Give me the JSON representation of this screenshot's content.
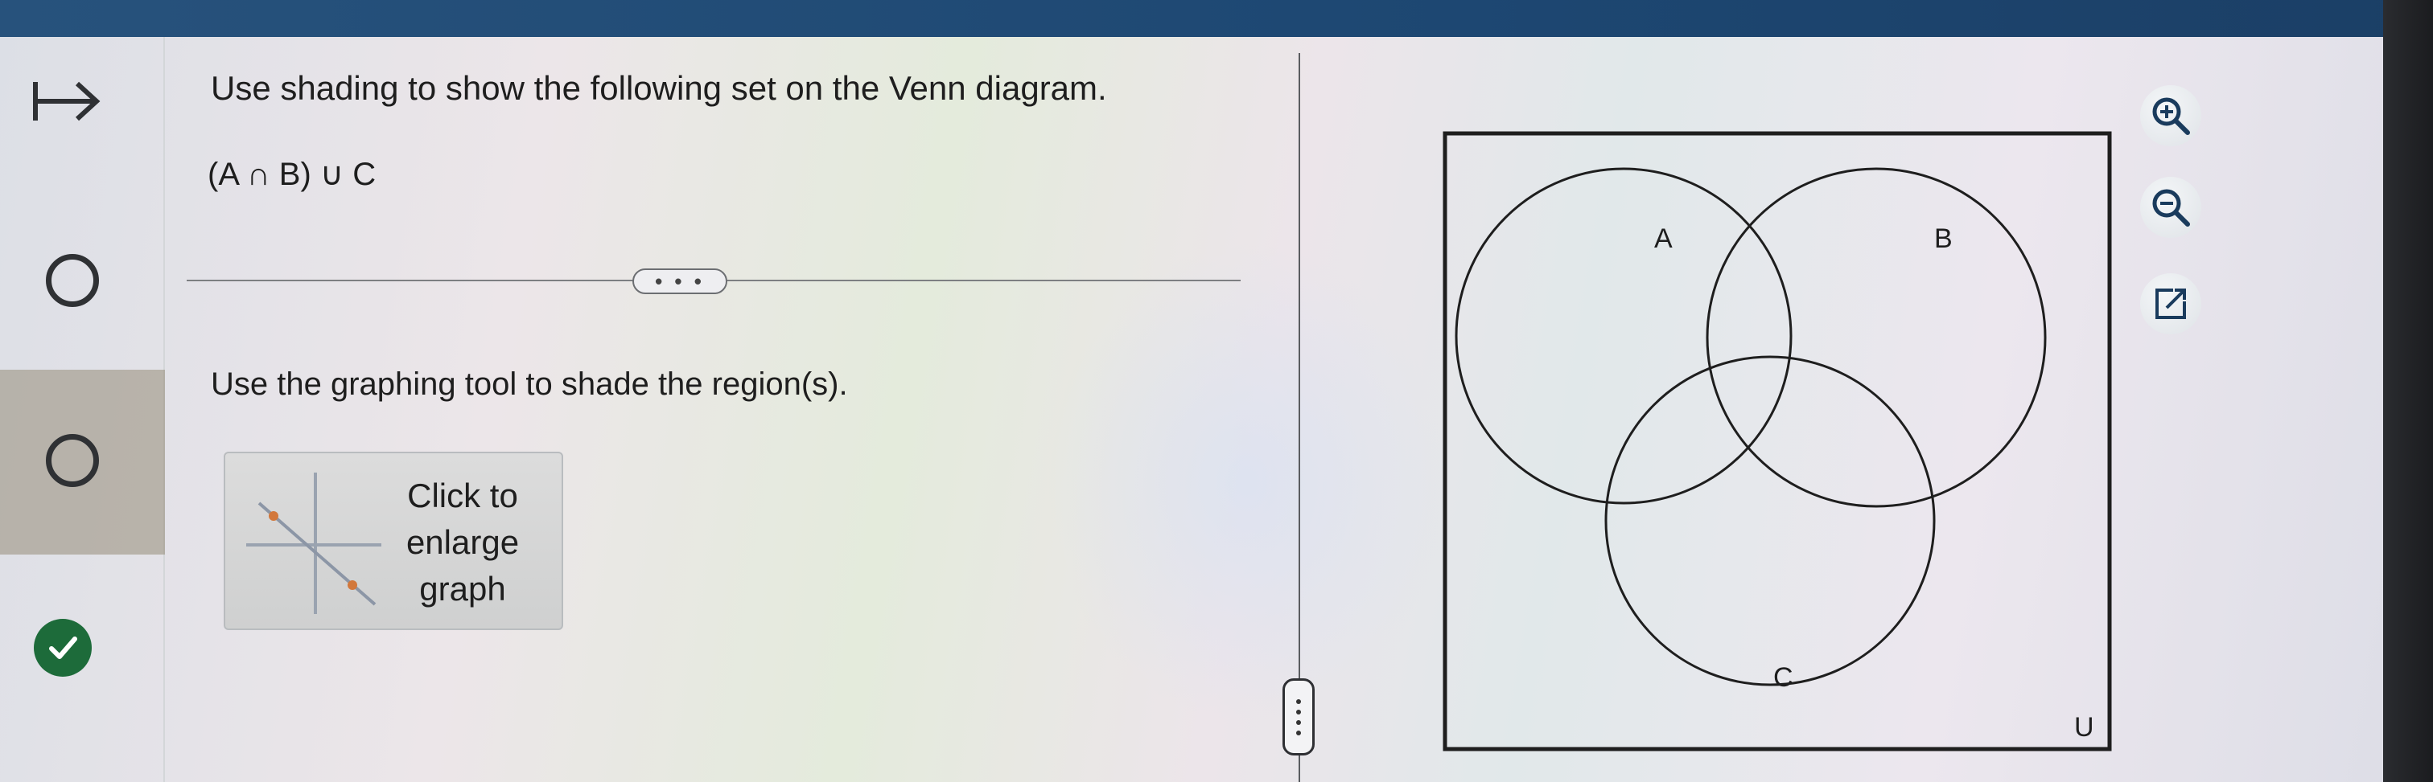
{
  "question": {
    "prompt": "Use shading to show the following set on the Venn diagram.",
    "expression": "(A ∩ B) ∪ C"
  },
  "toolbar": {
    "more_label": "• • •"
  },
  "instruction": "Use the graphing tool to shade the region(s).",
  "graph_button": {
    "line1": "Click to",
    "line2": "enlarge",
    "line3": "graph"
  },
  "venn": {
    "set_labels": [
      "A",
      "B",
      "C"
    ],
    "universe_label": "U"
  },
  "tools": {
    "icons": [
      "zoom-in-icon",
      "zoom-out-icon",
      "open-external-icon"
    ]
  },
  "left_rail": {
    "icons": [
      "collapse-arrow-icon",
      "radio-circle-icon",
      "radio-circle-icon",
      "check-circle-icon"
    ]
  },
  "colors": {
    "top_bar": "#1d4772",
    "check": "#1d6b3a",
    "accent_orange": "#d2783c"
  }
}
